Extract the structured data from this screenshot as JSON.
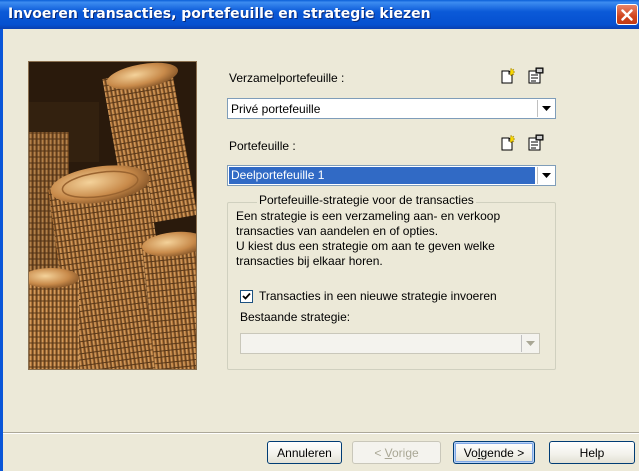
{
  "window": {
    "title": "Invoeren transacties, portefeuille en strategie kiezen"
  },
  "icons": {
    "close": "close-icon",
    "new": "new-document-icon",
    "properties": "properties-icon",
    "dropdown": "chevron-down-icon",
    "check": "check-icon"
  },
  "colors": {
    "title_bar": "#0a56d8",
    "selection": "#316ac5",
    "close_button": "#d0451e",
    "dialog_bg": "#ece9d8"
  },
  "form": {
    "collection_label": "Verzamelportefeuille :",
    "collection_value": "Privé portefeuille",
    "portfolio_label": "Portefeuille :",
    "portfolio_value": "Deelportefeuille 1"
  },
  "strategy_group": {
    "title": "Portefeuille-strategie voor de transacties",
    "description_lines": [
      "Een strategie is een verzameling aan- en verkoop",
      "transacties van aandelen en of opties.",
      "U kiest dus een strategie om aan te geven welke",
      "transacties bij elkaar horen."
    ],
    "checkbox_label": "Transacties in een nieuwe strategie invoeren",
    "checkbox_checked": true,
    "existing_label": "Bestaande strategie:",
    "existing_value": ""
  },
  "buttons": {
    "cancel": "Annuleren",
    "back_prefix": "< ",
    "back_mnemonic": "V",
    "back_rest": "orige",
    "next_prefix": "Vo",
    "next_mnemonic": "l",
    "next_rest": "gende >",
    "help": "Help"
  }
}
